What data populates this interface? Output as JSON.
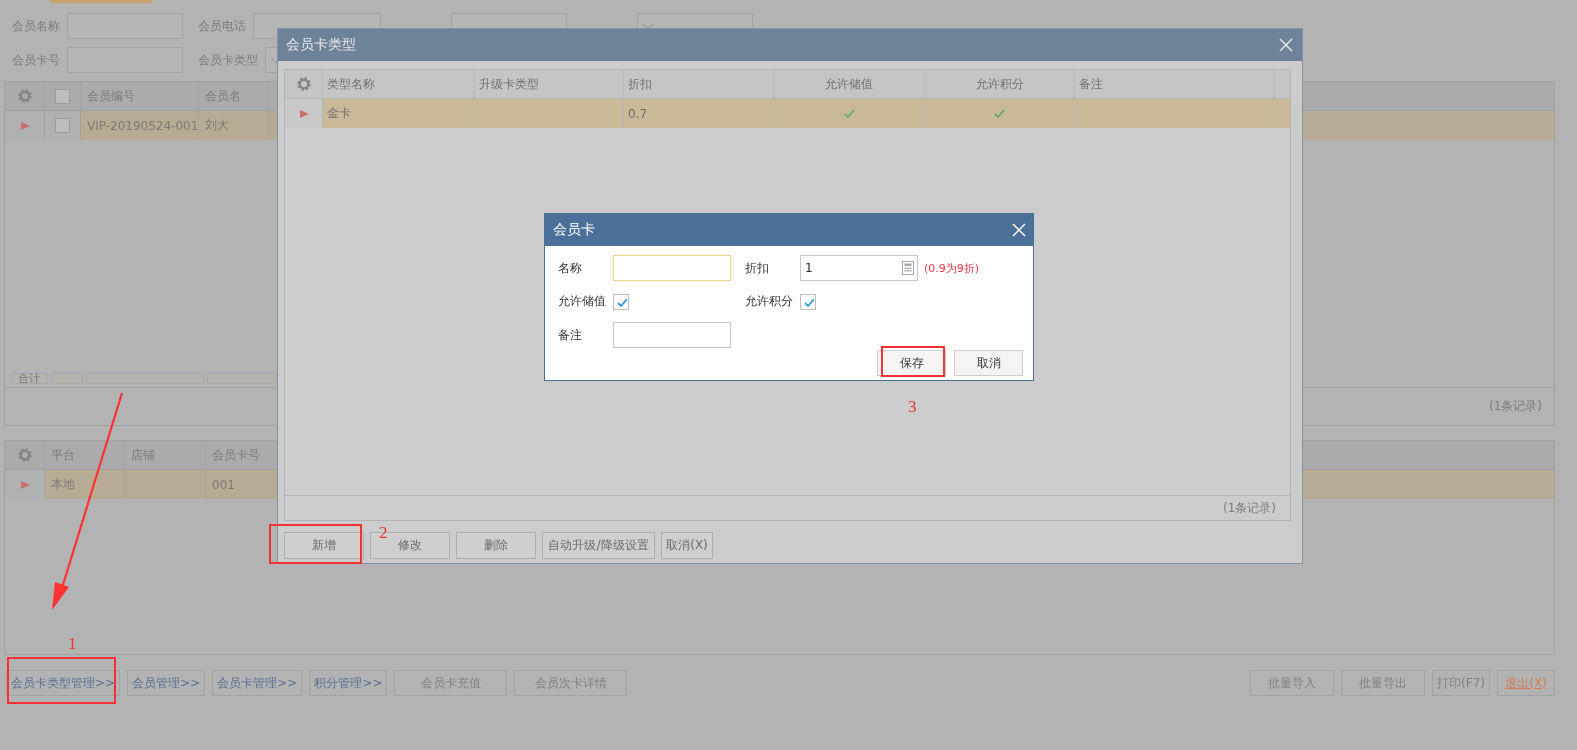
{
  "filter_rows": [
    [
      {
        "label": "会员名称",
        "kind": "input"
      },
      {
        "label": "会员电话",
        "kind": "input"
      },
      {
        "kind": "input"
      },
      {
        "kind": "select"
      }
    ],
    [
      {
        "label": "会员卡号",
        "kind": "input"
      },
      {
        "label": "会员卡类型",
        "kind": "select"
      }
    ]
  ],
  "member_grid": {
    "all_checked": false,
    "columns": [
      "会员编号",
      "会员名"
    ],
    "rows": [
      {
        "selected": true,
        "checked": false,
        "cells": [
          "VIP-20190524-001",
          "刘大"
        ]
      }
    ],
    "footer_label": "合计",
    "record_count": "(1条记录)"
  },
  "card_grid": {
    "columns": [
      "平台",
      "店铺",
      "会员卡号"
    ],
    "rows": [
      {
        "selected": true,
        "cells": [
          "本地",
          null,
          "001"
        ]
      }
    ]
  },
  "bottom_left_buttons": [
    {
      "label": "会员卡类型管理>>",
      "kind": "link"
    },
    {
      "label": "会员管理>>",
      "kind": "link"
    },
    {
      "label": "会员卡管理>>",
      "kind": "link"
    },
    {
      "label": "积分管理>>",
      "kind": "link"
    },
    {
      "label": "会员卡充值",
      "kind": "button"
    },
    {
      "label": "会员次卡详情",
      "kind": "button"
    }
  ],
  "bottom_right_buttons": [
    {
      "label": "批量导入",
      "kind": "button"
    },
    {
      "label": "批量导出",
      "kind": "button"
    },
    {
      "label": "打印(F7)",
      "kind": "button"
    },
    {
      "label": "退出(X)",
      "kind": "danger"
    }
  ],
  "card_type_dialog": {
    "title": "会员卡类型",
    "columns": [
      "类型名称",
      "升级卡类型",
      "折扣",
      "允许储值",
      "允许积分",
      "备注"
    ],
    "rows": [
      {
        "selected": true,
        "name": "金卡",
        "upgrade": null,
        "discount": "0.7",
        "allow_stored_value": true,
        "allow_points": true,
        "note": null
      }
    ],
    "record_count": "(1条记录)",
    "buttons": [
      "新增",
      "修改",
      "删除",
      "自动升级/降级设置",
      "取消(X)"
    ]
  },
  "card_dialog": {
    "title": "会员卡",
    "name": {
      "label": "名称",
      "focused": true
    },
    "discount": {
      "label": "折扣",
      "value": "1",
      "hint": "(0.9为9折)"
    },
    "allow_stored_value": {
      "label": "允许储值",
      "checked": true
    },
    "allow_points": {
      "label": "允许积分",
      "checked": true
    },
    "note": {
      "label": "备注"
    },
    "buttons": [
      "保存",
      "取消"
    ]
  },
  "annotations": [
    {
      "label": "1"
    },
    {
      "label": "2"
    },
    {
      "label": "3"
    }
  ]
}
